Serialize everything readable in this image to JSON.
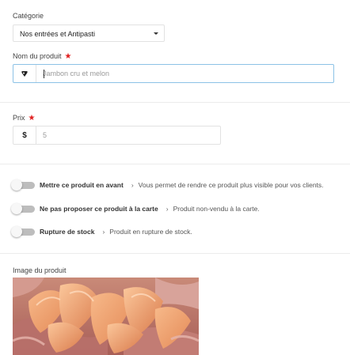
{
  "category": {
    "label": "Catégorie",
    "selected": "Nos entrées et Antipasti"
  },
  "product_name": {
    "label": "Nom du produit",
    "required_mark": "★",
    "placeholder": "Jambon cru et melon",
    "icon": "ham-icon"
  },
  "price": {
    "label": "Prix",
    "required_mark": "★",
    "currency_symbol": "$",
    "placeholder": "5"
  },
  "toggles": [
    {
      "label": "Mettre ce produit en avant",
      "hint": "Vous permet de rendre ce produit plus visible pour vos clients.",
      "on": false
    },
    {
      "label": "Ne pas proposer ce produit à la carte",
      "hint": "Produit non-vendu à la carte.",
      "on": false
    },
    {
      "label": "Rupture de stock",
      "hint": "Produit en rupture de stock.",
      "on": false
    }
  ],
  "hint_chevron": "›",
  "image": {
    "label": "Image du produit"
  },
  "colors": {
    "required": "#e02020",
    "focus_border": "#8cc2e6",
    "toggle_track": "#bdbdbd"
  }
}
